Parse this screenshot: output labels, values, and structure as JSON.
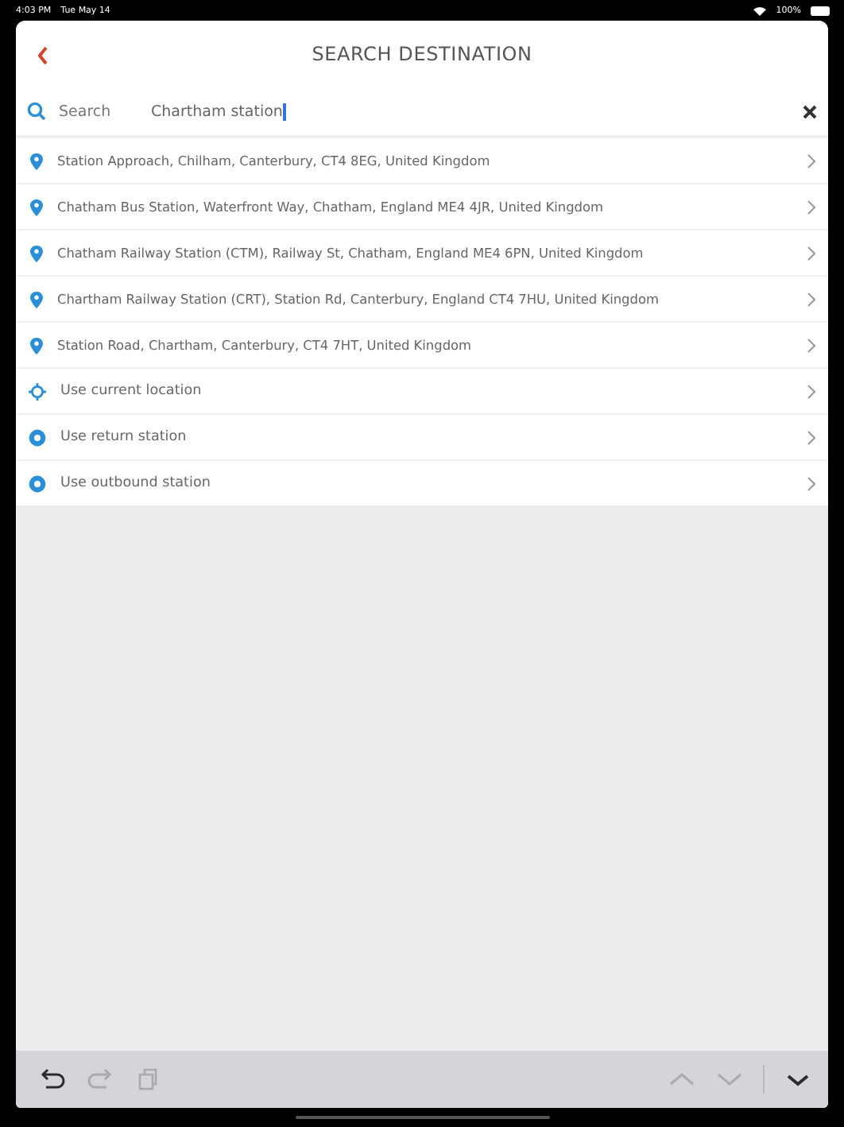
{
  "status_bar": {
    "time": "4:03 PM",
    "date": "Tue May 14",
    "battery": "100%"
  },
  "header": {
    "title": "SEARCH DESTINATION"
  },
  "search": {
    "label": "Search",
    "value": "Chartham station"
  },
  "results": [
    {
      "kind": "place",
      "text": "Station Approach, Chilham, Canterbury, CT4 8EG, United Kingdom"
    },
    {
      "kind": "place",
      "text": "Chatham Bus Station, Waterfront Way, Chatham, England ME4 4JR, United Kingdom"
    },
    {
      "kind": "place",
      "text": "Chatham Railway Station (CTM), Railway St, Chatham, England ME4 6PN, United Kingdom"
    },
    {
      "kind": "place",
      "text": "Chartham Railway Station (CRT), Station Rd, Canterbury, England CT4 7HU, United Kingdom"
    },
    {
      "kind": "place",
      "text": "Station Road, Chartham, Canterbury, CT4 7HT, United Kingdom"
    },
    {
      "kind": "location",
      "text": "Use current location"
    },
    {
      "kind": "station",
      "text": "Use return station"
    },
    {
      "kind": "station",
      "text": "Use outbound station"
    }
  ],
  "keyboard_toolbar": [
    {
      "kind": "undo",
      "disabled": false
    },
    {
      "kind": "redo",
      "disabled": true
    },
    {
      "kind": "paste",
      "disabled": true
    },
    {
      "kind": "up",
      "disabled": true
    },
    {
      "kind": "down",
      "disabled": true
    },
    {
      "kind": "dismiss",
      "disabled": false
    }
  ]
}
